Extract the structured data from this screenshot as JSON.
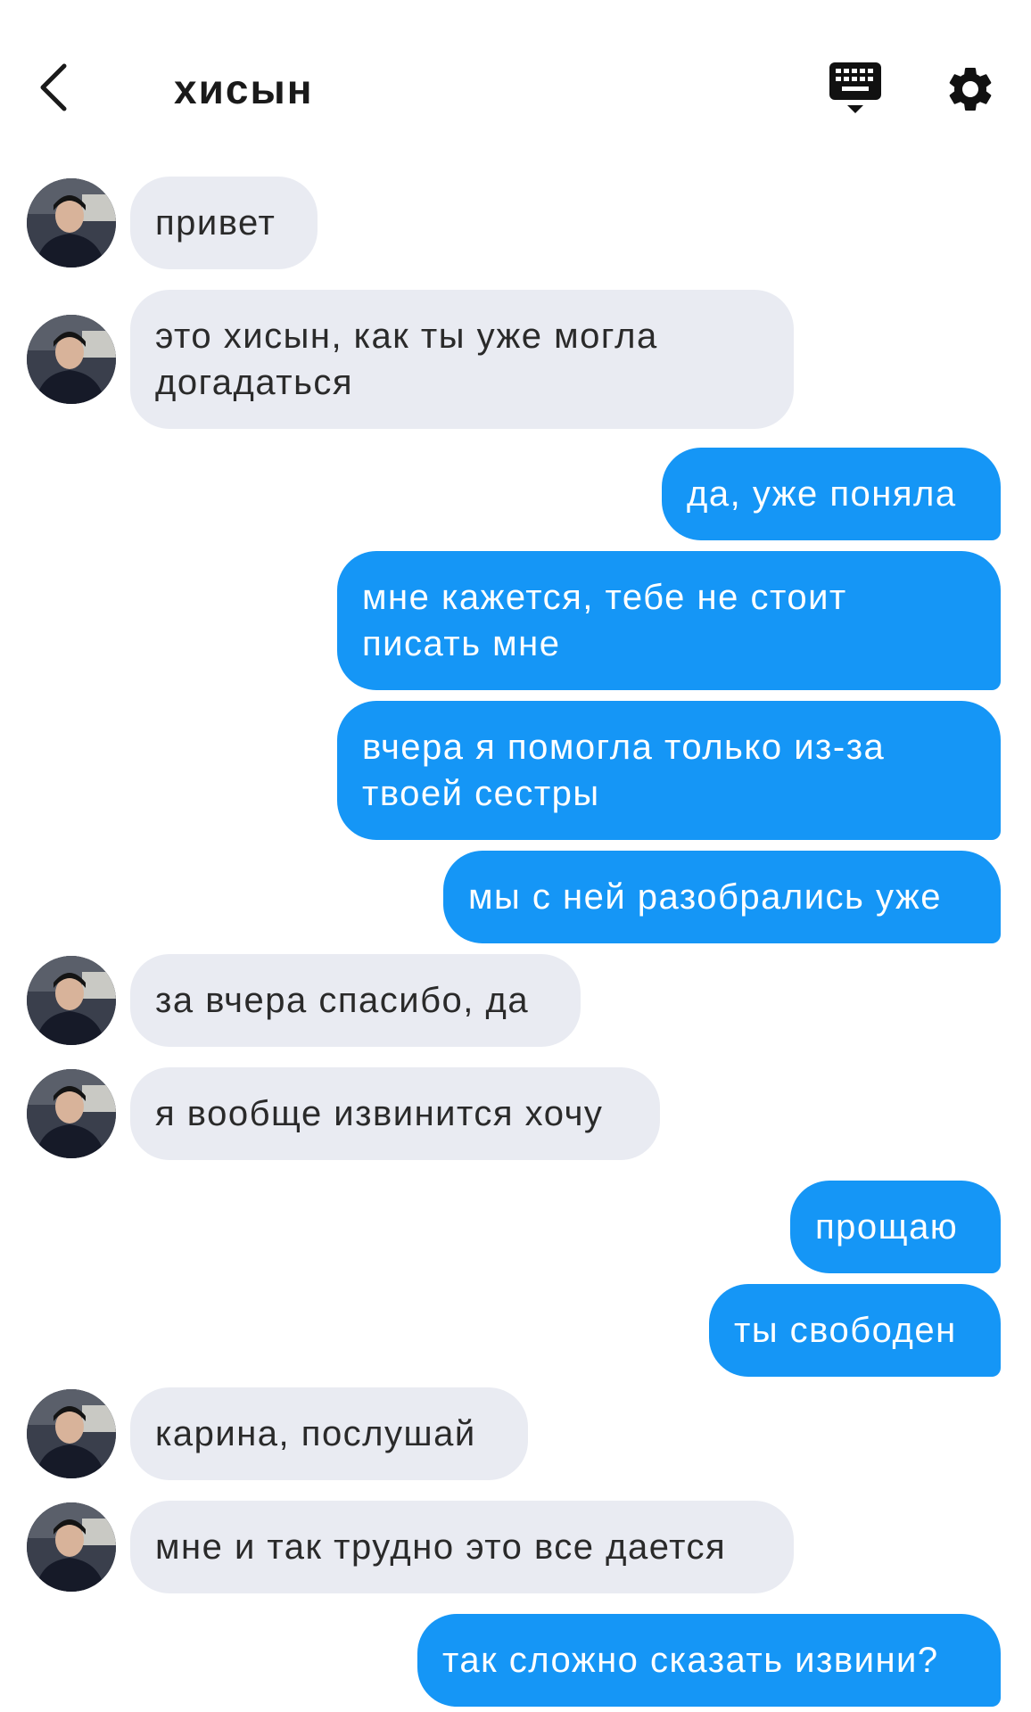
{
  "header": {
    "title": "хисын",
    "back_icon": "chevron-left-icon",
    "keyboard_icon": "keyboard-icon",
    "settings_icon": "gear-icon"
  },
  "colors": {
    "outgoing_bubble": "#1596f6",
    "incoming_bubble": "#e9ebf2"
  },
  "messages": [
    {
      "from": "them",
      "text": "привет"
    },
    {
      "from": "them",
      "text": "это хисын, как ты уже могла\nдогадаться"
    },
    {
      "from": "me",
      "text": "да, уже поняла"
    },
    {
      "from": "me",
      "text": "мне кажется, тебе не стоит\nписать мне"
    },
    {
      "from": "me",
      "text": "вчера я помогла только из-за\nтвоей сестры"
    },
    {
      "from": "me",
      "text": "мы с ней разобрались уже"
    },
    {
      "from": "them",
      "text": "за вчера спасибо, да"
    },
    {
      "from": "them",
      "text": "я вообще извинится хочу"
    },
    {
      "from": "me",
      "text": "прощаю"
    },
    {
      "from": "me",
      "text": "ты свободен"
    },
    {
      "from": "them",
      "text": "карина, послушай"
    },
    {
      "from": "them",
      "text": "мне и так трудно это все дается"
    },
    {
      "from": "me",
      "text": "так сложно сказать извини?"
    }
  ]
}
